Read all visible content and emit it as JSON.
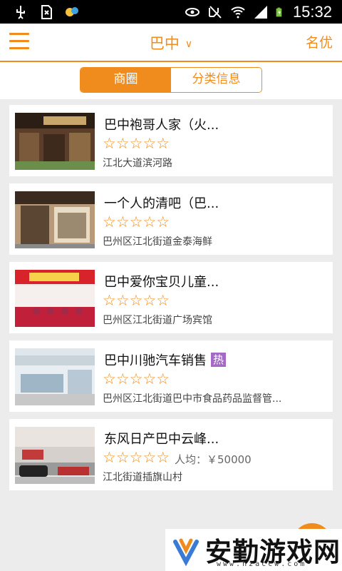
{
  "status_bar": {
    "time": "15:32",
    "icons": [
      "usb-icon",
      "sd-icon",
      "app-icon",
      "eye-icon",
      "mute-icon",
      "wifi-icon",
      "signal-icon",
      "battery-icon"
    ]
  },
  "header": {
    "city": "巴中",
    "right_link": "名优",
    "menu_icon": "hamburger-menu-icon"
  },
  "tabs": {
    "active": "商圈",
    "inactive": "分类信息"
  },
  "stores": [
    {
      "name": "巴中袍哥人家（火...",
      "rating_stars": 0,
      "address": "江北大道滨河路",
      "hot": "",
      "avg": ""
    },
    {
      "name": "一个人的清吧（巴...",
      "rating_stars": 0,
      "address": "巴州区江北街道金泰海鲜",
      "hot": "",
      "avg": ""
    },
    {
      "name": "巴中爱你宝贝儿童...",
      "rating_stars": 0,
      "address": "巴州区江北街道广场宾馆",
      "hot": "",
      "avg": ""
    },
    {
      "name": "巴中川驰汽车销售",
      "rating_stars": 0,
      "address": "巴州区江北街道巴中市食品药品监督管...",
      "hot": "热",
      "avg": ""
    },
    {
      "name": "东风日产巴中云峰...",
      "rating_stars": 0,
      "address": "江北街道插旗山村",
      "hot": "",
      "avg": "人均：￥50000"
    }
  ],
  "stars_text": "☆☆☆☆☆",
  "watermark": {
    "text": "安勤游戏网",
    "url": "www.hzaccw.com"
  },
  "colors": {
    "accent": "#f08c1d",
    "hot_badge": "#a569c8",
    "background": "#ececec"
  }
}
